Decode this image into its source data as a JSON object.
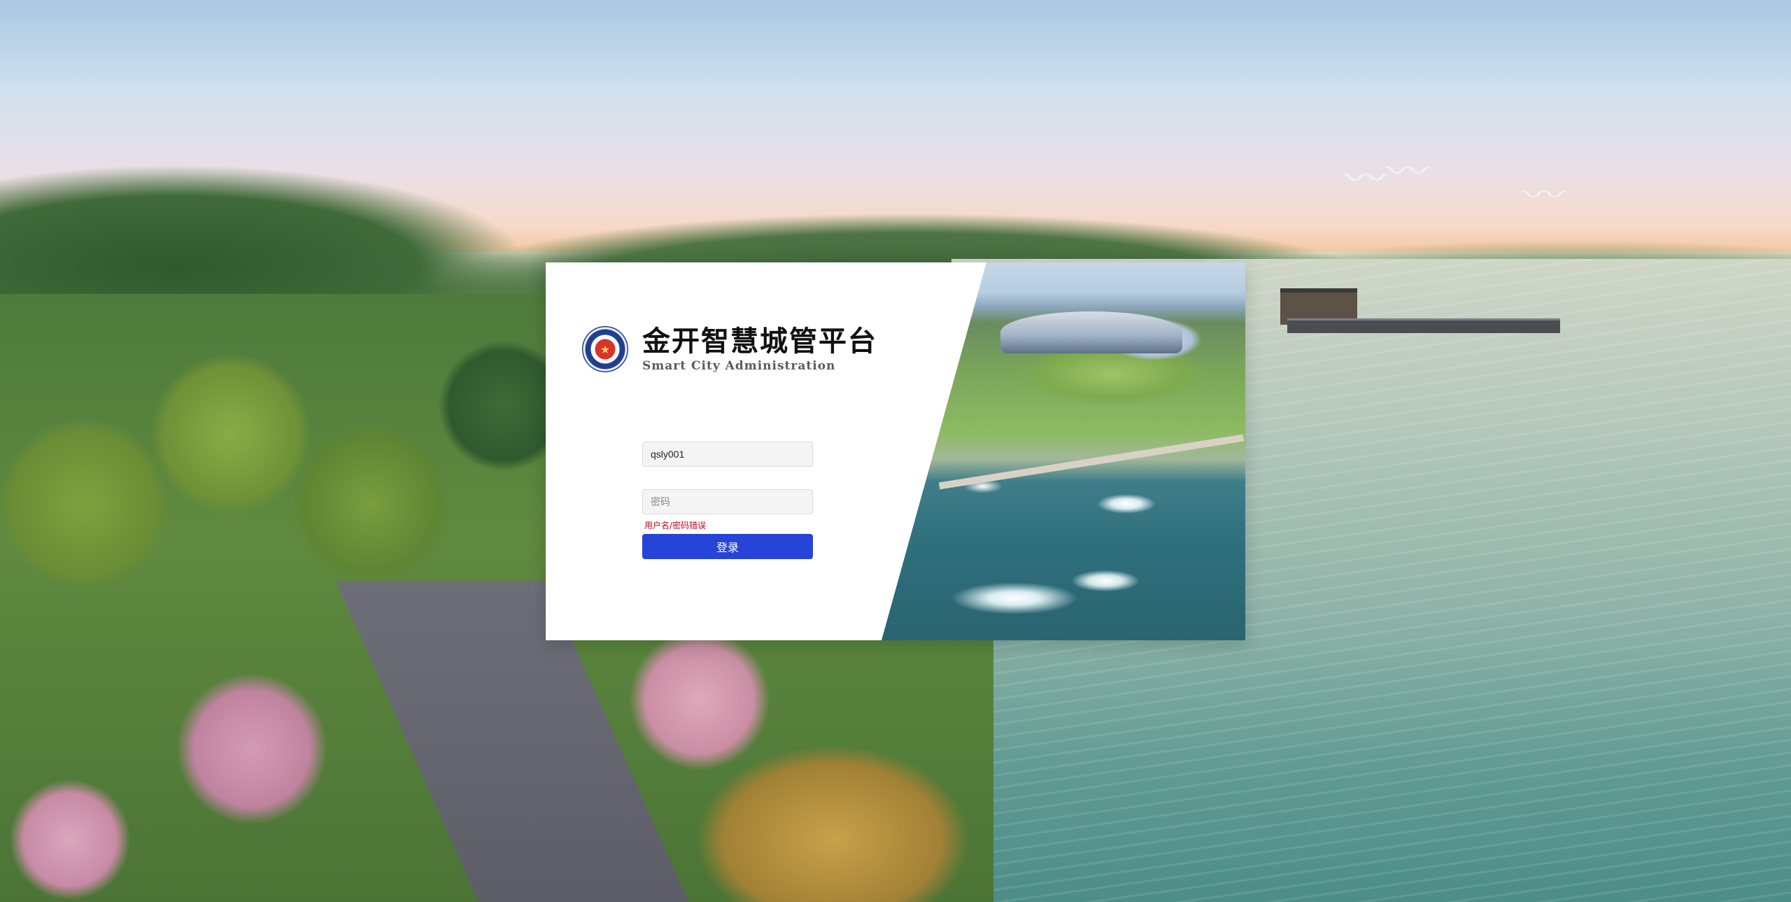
{
  "app": {
    "title": "金开智慧城管平台",
    "subtitle": "Smart City Administration",
    "emblem_icon": "police-emblem-icon"
  },
  "login": {
    "username_value": "qsly001",
    "password_placeholder": "密码",
    "error_message": "用户名/密码错误",
    "submit_label": "登录"
  },
  "colors": {
    "primary_button": "#2744d9",
    "error_text": "#d0021b",
    "card_background": "#ffffff"
  }
}
